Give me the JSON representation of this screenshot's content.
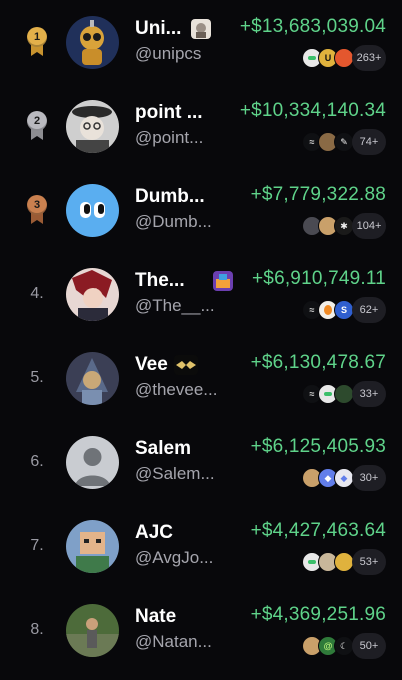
{
  "leaderboard": [
    {
      "rank": "1",
      "medal": "gold",
      "name": "Uni...",
      "has_badge": true,
      "handle": "@unipcs",
      "pnl": "+$13,683,039.04",
      "tokens": [
        "pump-pill-icon",
        "gold-coin-icon",
        "orange-coin-icon"
      ],
      "more": "263+"
    },
    {
      "rank": "2",
      "medal": "silver",
      "name": "point ...",
      "has_badge": false,
      "handle": "@point...",
      "pnl": "+$10,334,140.34",
      "tokens": [
        "dash-token-icon",
        "brown-coin-icon",
        "white-feather-icon"
      ],
      "more": "74+"
    },
    {
      "rank": "3",
      "medal": "bronze",
      "name": "Dumb...",
      "has_badge": false,
      "handle": "@Dumb...",
      "pnl": "+$7,779,322.88",
      "tokens": [
        "dark-coin-icon",
        "dog-coin-icon",
        "star-coin-icon"
      ],
      "more": "104+"
    },
    {
      "rank": "4.",
      "medal": "",
      "name": "The...",
      "has_badge": true,
      "handle": "@The__...",
      "pnl": "+$6,910,749.11",
      "tokens": [
        "dash-token-icon",
        "orange-egg-icon",
        "blue-coin-icon"
      ],
      "more": "62+"
    },
    {
      "rank": "5.",
      "medal": "",
      "name": "Vee",
      "has_badge": true,
      "handle": "@thevee...",
      "pnl": "+$6,130,478.67",
      "tokens": [
        "dash-token-icon",
        "pump-pill-icon",
        "green-coin-icon"
      ],
      "more": "33+"
    },
    {
      "rank": "6.",
      "medal": "",
      "name": "Salem",
      "has_badge": false,
      "handle": "@Salem...",
      "pnl": "+$6,125,405.93",
      "tokens": [
        "dog-coin-icon",
        "ethereum-icon",
        "ethereum-icon"
      ],
      "more": "30+"
    },
    {
      "rank": "7.",
      "medal": "",
      "name": "AJC",
      "has_badge": false,
      "handle": "@AvgJo...",
      "pnl": "+$4,427,463.64",
      "tokens": [
        "pump-pill-icon",
        "cat-coin-icon",
        "gold-coin-icon"
      ],
      "more": "53+"
    },
    {
      "rank": "8.",
      "medal": "",
      "name": "Nate",
      "has_badge": false,
      "handle": "@Natan...",
      "pnl": "+$4,369,251.96",
      "tokens": [
        "dog-coin-icon",
        "green-swirl-icon",
        "white-moon-icon"
      ],
      "more": "50+"
    }
  ],
  "colors": {
    "background": "#08080b",
    "pnl_green": "#5fd38a",
    "handle_gray": "#a5a5ad",
    "pill_bg": "#1e1e24"
  }
}
